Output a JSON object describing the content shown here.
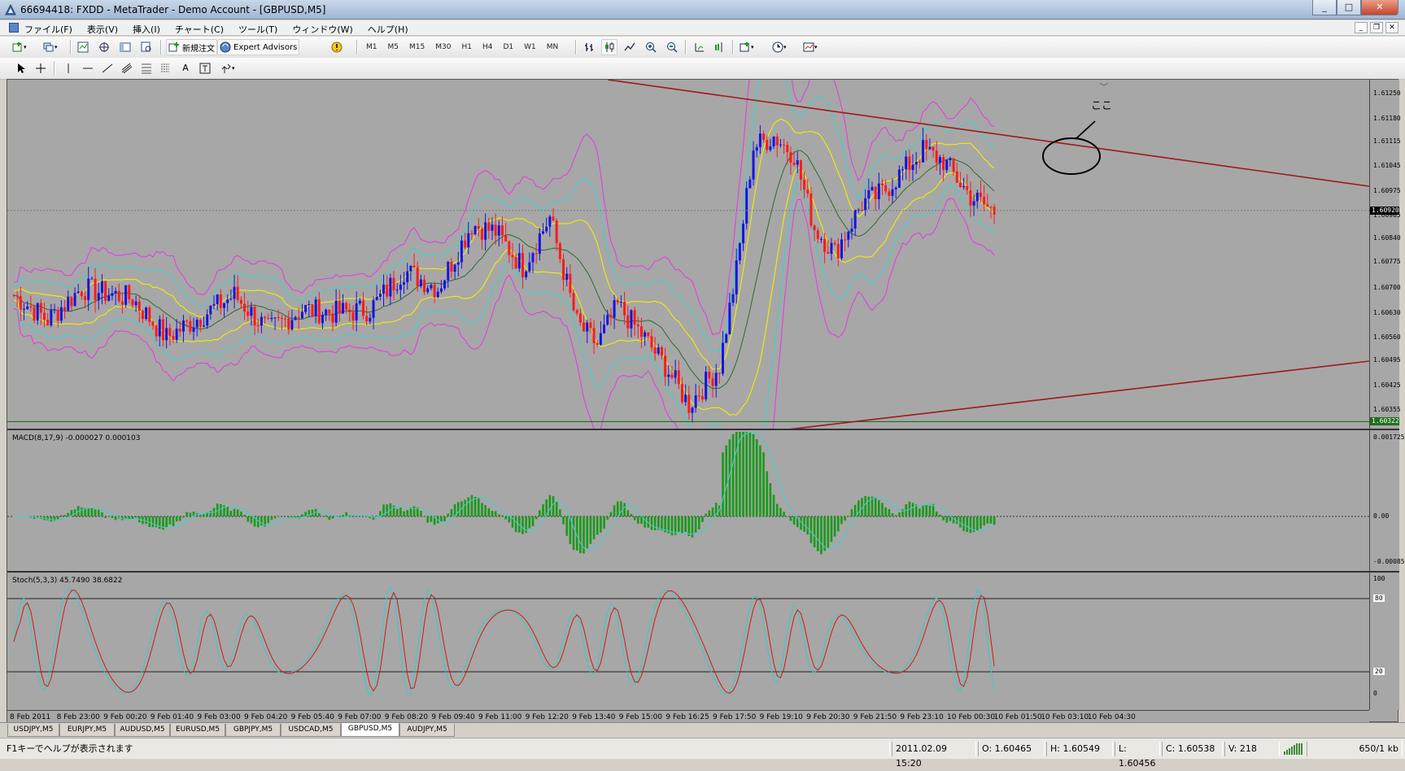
{
  "window": {
    "title": "66694418: FXDD - MetaTrader - Demo Account - [GBPUSD,M5]",
    "min": "_",
    "max": "□",
    "close": "✕"
  },
  "menu": [
    "ファイル(F)",
    "表示(V)",
    "挿入(I)",
    "チャート(C)",
    "ツール(T)",
    "ウィンドウ(W)",
    "ヘルプ(H)"
  ],
  "toolbar": {
    "new_order": "新規注文",
    "expert_advisors": "Expert Advisors"
  },
  "timeframes": [
    "M1",
    "M5",
    "M15",
    "M30",
    "H1",
    "H4",
    "D1",
    "W1",
    "MN"
  ],
  "chart": {
    "symbol": "GBPUSD,M5",
    "annotation": "ここ",
    "colors": {
      "bg": "#a7a7a7",
      "bull": "#1414e0",
      "bear": "#ff1a1a",
      "bb_outer": "#e040e0",
      "bb_mid": "#40d0d0",
      "bb_inner": "#f0f000",
      "ma": "#2d6b2d",
      "trendline": "#a01818",
      "hline": "#1f6f1f"
    },
    "price_labels": [
      "1.61250",
      "1.61180",
      "1.61115",
      "1.61045",
      "1.60975",
      "1.60905",
      "1.60840",
      "1.60775",
      "1.60700",
      "1.60630",
      "1.60560",
      "1.60495",
      "1.60425",
      "1.60355",
      "1.60322"
    ],
    "current_price": "1.60920",
    "hline_price": "1.60322",
    "macd_label": "MACD(8,17,9) -0.000027 0.000103",
    "macd_scale": [
      "0.001725",
      "0.00",
      "-0.00085"
    ],
    "stoch_label": "Stoch(5,3,3) 45.7490 38.6822",
    "stoch_scale": [
      "100",
      "80",
      "20",
      "0"
    ],
    "time_labels": [
      "8 Feb 2011",
      "8 Feb 23:00",
      "9 Feb 00:20",
      "9 Feb 01:40",
      "9 Feb 03:00",
      "9 Feb 04:20",
      "9 Feb 05:40",
      "9 Feb 07:00",
      "9 Feb 08:20",
      "9 Feb 09:40",
      "9 Feb 11:00",
      "9 Feb 12:20",
      "9 Feb 13:40",
      "9 Feb 15:00",
      "9 Feb 16:25",
      "9 Feb 17:50",
      "9 Feb 19:10",
      "9 Feb 20:30",
      "9 Feb 21:50",
      "9 Feb 23:10",
      "10 Feb 00:30",
      "10 Feb 01:50",
      "10 Feb 03:10",
      "10 Feb 04:30"
    ]
  },
  "tabs": [
    "USDJPY,M5",
    "EURJPY,M5",
    "AUDUSD,M5",
    "EURUSD,M5",
    "GBPJPY,M5",
    "USDCAD,M5",
    "GBPUSD,M5",
    "AUDJPY,M5"
  ],
  "active_tab": 6,
  "status": {
    "help": "F1キーでヘルプが表示されます",
    "datetime": "2011.02.09 15:20",
    "open": "O: 1.60465",
    "high": "H: 1.60549",
    "low": "L: 1.60456",
    "close": "C: 1.60538",
    "volume": "V: 218",
    "traffic": "650/1 kb"
  }
}
